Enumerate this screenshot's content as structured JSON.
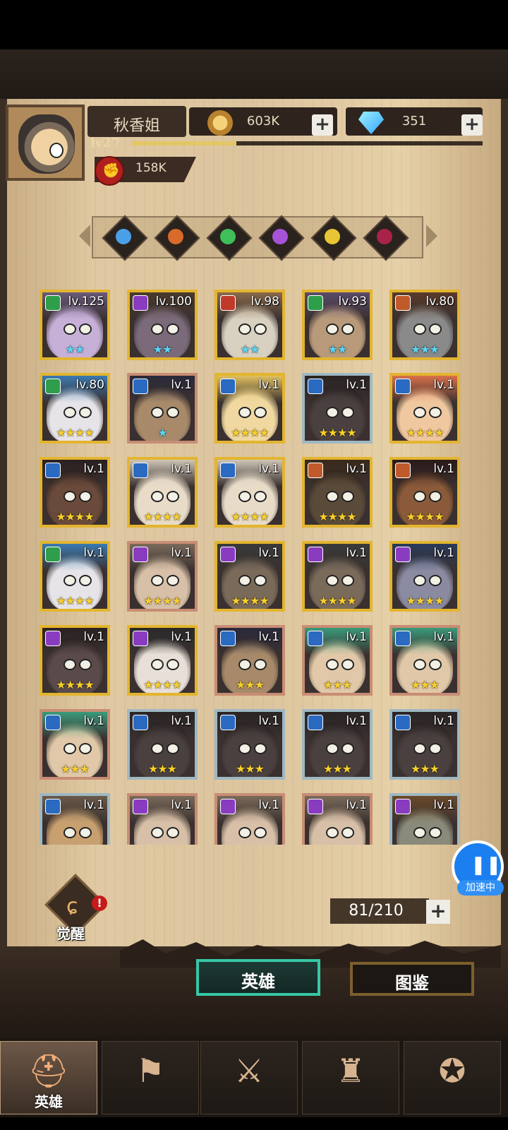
{
  "player": {
    "name": "秋香姐",
    "level": "lv27",
    "xp_fraction": 0.3,
    "power": "158K"
  },
  "resources": {
    "gold": "603K",
    "diamonds": "351"
  },
  "filters": [
    {
      "icon": "wind-element-icon",
      "color": "#4aa0e8"
    },
    {
      "icon": "fire-element-icon",
      "color": "#d86a2a"
    },
    {
      "icon": "nature-element-icon",
      "color": "#3fbf59"
    },
    {
      "icon": "arcane-element-icon",
      "color": "#a653d8"
    },
    {
      "icon": "light-element-icon",
      "color": "#e8c534"
    },
    {
      "icon": "dark-element-icon",
      "color": "#a8234a"
    }
  ],
  "heroes": [
    {
      "level": "lv.125",
      "stars": 2,
      "star_color": "blue",
      "frame": "gold",
      "badge": "#2e9e4a",
      "skin": "#c6b0d8",
      "hair": "#6a5a7a"
    },
    {
      "level": "lv.100",
      "stars": 2,
      "star_color": "blue",
      "frame": "gold",
      "badge": "#8a3cc0",
      "skin": "#7a6a7a",
      "hair": "#4a3a2a"
    },
    {
      "level": "lv.98",
      "stars": 2,
      "star_color": "blue",
      "frame": "gold",
      "badge": "#c03a2a",
      "skin": "#d8d0c0",
      "hair": "#8a6a4a"
    },
    {
      "level": "lv.93",
      "stars": 2,
      "star_color": "blue",
      "frame": "gold",
      "badge": "#2e9e4a",
      "skin": "#b89a7a",
      "hair": "#5a4a6a"
    },
    {
      "level": "lv.80",
      "stars": 3,
      "star_color": "blue",
      "frame": "gold",
      "badge": "#c05a2a",
      "skin": "#8a8a8a",
      "hair": "#5a3a2a"
    },
    {
      "level": "lv.80",
      "stars": 4,
      "star_color": "gold",
      "frame": "gold",
      "badge": "#2e9e4a",
      "skin": "#e6e4e8",
      "hair": "#3a7ab0"
    },
    {
      "level": "lv.1",
      "stars": 1,
      "star_color": "blue",
      "frame": "bronze",
      "badge": "#2a6ac0",
      "skin": "#a88a6a",
      "hair": "#2a2a3a"
    },
    {
      "level": "lv.1",
      "stars": 4,
      "star_color": "gold",
      "frame": "gold",
      "badge": "#2a6ac0",
      "skin": "#f0d8a0",
      "hair": "#e0c060"
    },
    {
      "level": "lv.1",
      "stars": 4,
      "star_color": "gold",
      "frame": "silver",
      "badge": "#2a6ac0",
      "skin": "#4a4040",
      "hair": "#2a2424"
    },
    {
      "level": "lv.1",
      "stars": 4,
      "star_color": "gold",
      "frame": "gold",
      "badge": "#2a6ac0",
      "skin": "#f0c8a0",
      "hair": "#d8704a"
    },
    {
      "level": "lv.1",
      "stars": 4,
      "star_color": "gold",
      "frame": "gold",
      "badge": "#2a6ac0",
      "skin": "#6a4a3a",
      "hair": "#2a2020"
    },
    {
      "level": "lv.1",
      "stars": 4,
      "star_color": "gold",
      "frame": "gold",
      "badge": "#2a6ac0",
      "skin": "#e8dcc8",
      "hair": "#cfc6b6"
    },
    {
      "level": "lv.1",
      "stars": 4,
      "star_color": "gold",
      "frame": "gold",
      "badge": "#2a6ac0",
      "skin": "#e8dcc8",
      "hair": "#cfc6b6"
    },
    {
      "level": "lv.1",
      "stars": 4,
      "star_color": "gold",
      "frame": "gold",
      "badge": "#c05a2a",
      "skin": "#5a4a3a",
      "hair": "#3a2a1a"
    },
    {
      "level": "lv.1",
      "stars": 4,
      "star_color": "gold",
      "frame": "gold",
      "badge": "#c05a2a",
      "skin": "#8a5a3a",
      "hair": "#2a1a1a"
    },
    {
      "level": "lv.1",
      "stars": 4,
      "star_color": "gold",
      "frame": "gold",
      "badge": "#2e9e4a",
      "skin": "#e6e4e8",
      "hair": "#3a7ab0"
    },
    {
      "level": "lv.1",
      "stars": 4,
      "star_color": "gold",
      "frame": "bronze",
      "badge": "#8a3cc0",
      "skin": "#d8c0a8",
      "hair": "#7a6a5a"
    },
    {
      "level": "lv.1",
      "stars": 4,
      "star_color": "gold",
      "frame": "gold",
      "badge": "#8a3cc0",
      "skin": "#7a6a5a",
      "hair": "#3a3a3a"
    },
    {
      "level": "lv.1",
      "stars": 4,
      "star_color": "gold",
      "frame": "gold",
      "badge": "#8a3cc0",
      "skin": "#7a6a5a",
      "hair": "#3a3a3a"
    },
    {
      "level": "lv.1",
      "stars": 4,
      "star_color": "gold",
      "frame": "gold",
      "badge": "#8a3cc0",
      "skin": "#8a8aa0",
      "hair": "#2a3a5a"
    },
    {
      "level": "lv.1",
      "stars": 4,
      "star_color": "gold",
      "frame": "gold",
      "badge": "#8a3cc0",
      "skin": "#5a4a4a",
      "hair": "#2a2222"
    },
    {
      "level": "lv.1",
      "stars": 4,
      "star_color": "gold",
      "frame": "gold",
      "badge": "#8a3cc0",
      "skin": "#e8e0d8",
      "hair": "#2a2a2a"
    },
    {
      "level": "lv.1",
      "stars": 3,
      "star_color": "gold",
      "frame": "bronze",
      "badge": "#2a6ac0",
      "skin": "#a88a6a",
      "hair": "#2a2a3a"
    },
    {
      "level": "lv.1",
      "stars": 3,
      "star_color": "gold",
      "frame": "bronze",
      "badge": "#2a6ac0",
      "skin": "#e0c8a8",
      "hair": "#3a9a7a"
    },
    {
      "level": "lv.1",
      "stars": 3,
      "star_color": "gold",
      "frame": "bronze",
      "badge": "#2a6ac0",
      "skin": "#e0c8a8",
      "hair": "#3a9a7a"
    },
    {
      "level": "lv.1",
      "stars": 3,
      "star_color": "gold",
      "frame": "bronze",
      "badge": "#2a6ac0",
      "skin": "#e0c8a8",
      "hair": "#3a9a7a"
    },
    {
      "level": "lv.1",
      "stars": 3,
      "star_color": "gold",
      "frame": "silver",
      "badge": "#2a6ac0",
      "skin": "#4a4040",
      "hair": "#2a2424"
    },
    {
      "level": "lv.1",
      "stars": 3,
      "star_color": "gold",
      "frame": "silver",
      "badge": "#2a6ac0",
      "skin": "#4a4040",
      "hair": "#2a2424"
    },
    {
      "level": "lv.1",
      "stars": 3,
      "star_color": "gold",
      "frame": "silver",
      "badge": "#2a6ac0",
      "skin": "#4a4040",
      "hair": "#2a2424"
    },
    {
      "level": "lv.1",
      "stars": 3,
      "star_color": "gold",
      "frame": "silver",
      "badge": "#2a6ac0",
      "skin": "#4a4040",
      "hair": "#2a2424"
    },
    {
      "level": "lv.1",
      "stars": 0,
      "star_color": "gold",
      "frame": "silver",
      "badge": "#2a6ac0",
      "skin": "#c8a070",
      "hair": "#6a5a4a"
    },
    {
      "level": "lv.1",
      "stars": 0,
      "star_color": "gold",
      "frame": "bronze",
      "badge": "#8a3cc0",
      "skin": "#d8c0a8",
      "hair": "#7a6a5a"
    },
    {
      "level": "lv.1",
      "stars": 0,
      "star_color": "gold",
      "frame": "bronze",
      "badge": "#8a3cc0",
      "skin": "#d8c0a8",
      "hair": "#7a6a5a"
    },
    {
      "level": "lv.1",
      "stars": 0,
      "star_color": "gold",
      "frame": "bronze",
      "badge": "#8a3cc0",
      "skin": "#d8c0a8",
      "hair": "#7a6a5a"
    },
    {
      "level": "lv.1",
      "stars": 0,
      "star_color": "gold",
      "frame": "silver",
      "badge": "#8a3cc0",
      "skin": "#8a8a7a",
      "hair": "#6a4a2a"
    }
  ],
  "speed_button": {
    "label": "加速中"
  },
  "awaken": {
    "label": "觉醒",
    "alert": "!"
  },
  "hero_count": "81/210",
  "tabs": {
    "heroes": "英雄",
    "codex": "图鉴"
  },
  "nav": [
    {
      "icon": "helmet-icon",
      "label": "英雄",
      "active": true
    },
    {
      "icon": "war-flag-icon",
      "label": "",
      "active": false
    },
    {
      "icon": "battle-crossed-swords-icon",
      "label": "",
      "active": false
    },
    {
      "icon": "castle-tower-icon",
      "label": "",
      "active": false
    },
    {
      "icon": "guild-handshake-icon",
      "label": "",
      "active": false
    }
  ]
}
